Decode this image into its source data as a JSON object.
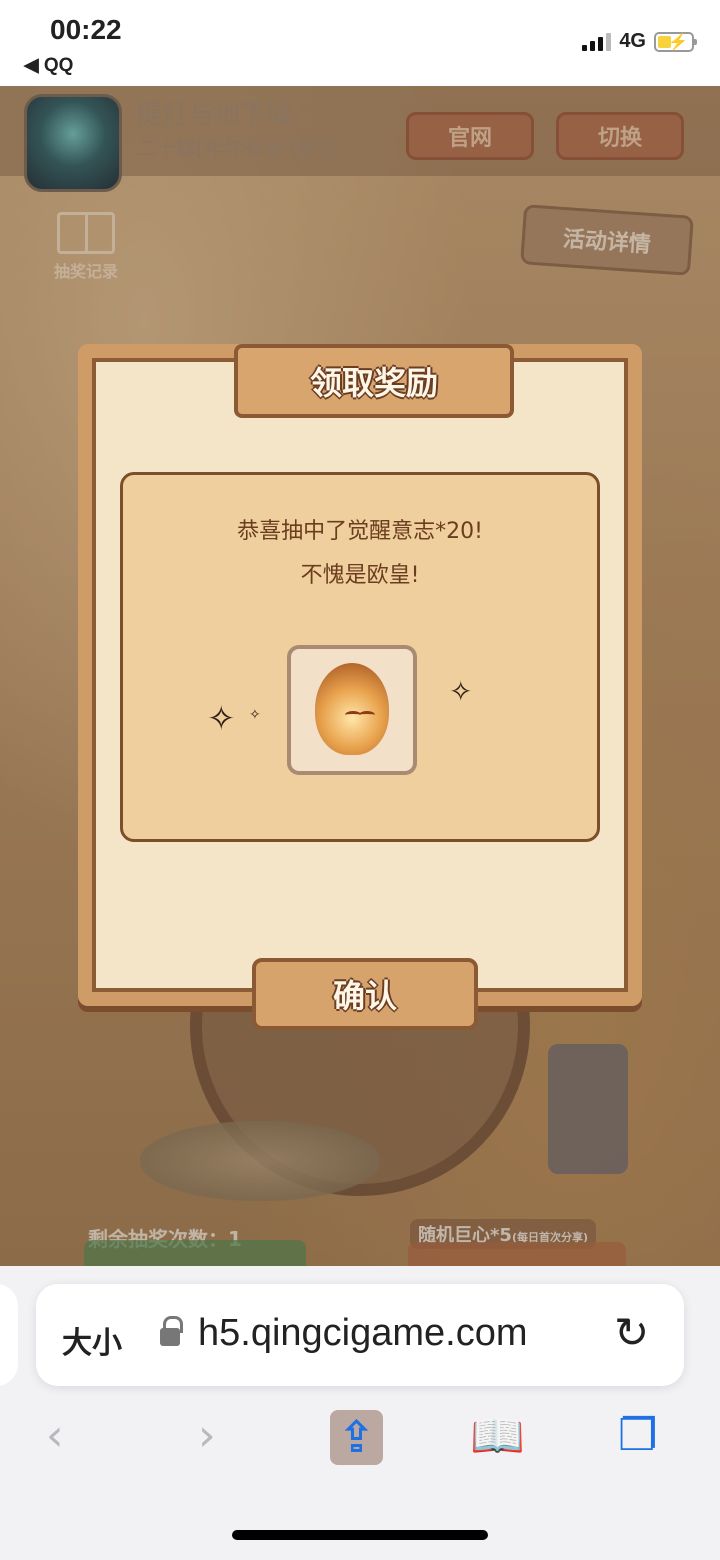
{
  "status_bar": {
    "time": "00:22",
    "back_label": "◀ QQ",
    "network": "4G",
    "battery_color": "#f7d23b"
  },
  "game": {
    "app_title": "提灯与地下城",
    "app_subtitle": "二十肆[年年有余 (新)]",
    "buttons": {
      "official": "官网",
      "switch": "切换",
      "records": "抽奖记录",
      "details": "活动详情"
    },
    "remaining_text": "剩余抽奖次数：1",
    "share_text": "随机巨心*5",
    "share_note": "(每日首次分享)"
  },
  "modal": {
    "title": "领取奖励",
    "message_line1": "恭喜抽中了觉醒意志*20!",
    "message_line2": "不愧是欧皇!",
    "item_icon": "flame-spirit-icon",
    "confirm_label": "确认"
  },
  "browser": {
    "text_size_label": "大小",
    "url": "h5.qingcigame.com"
  },
  "colors": {
    "modal_frame": "#cf9c68",
    "modal_panel": "#f0cf9e",
    "text_brown": "#6a3d1f",
    "link_blue": "#1f6fe5"
  }
}
